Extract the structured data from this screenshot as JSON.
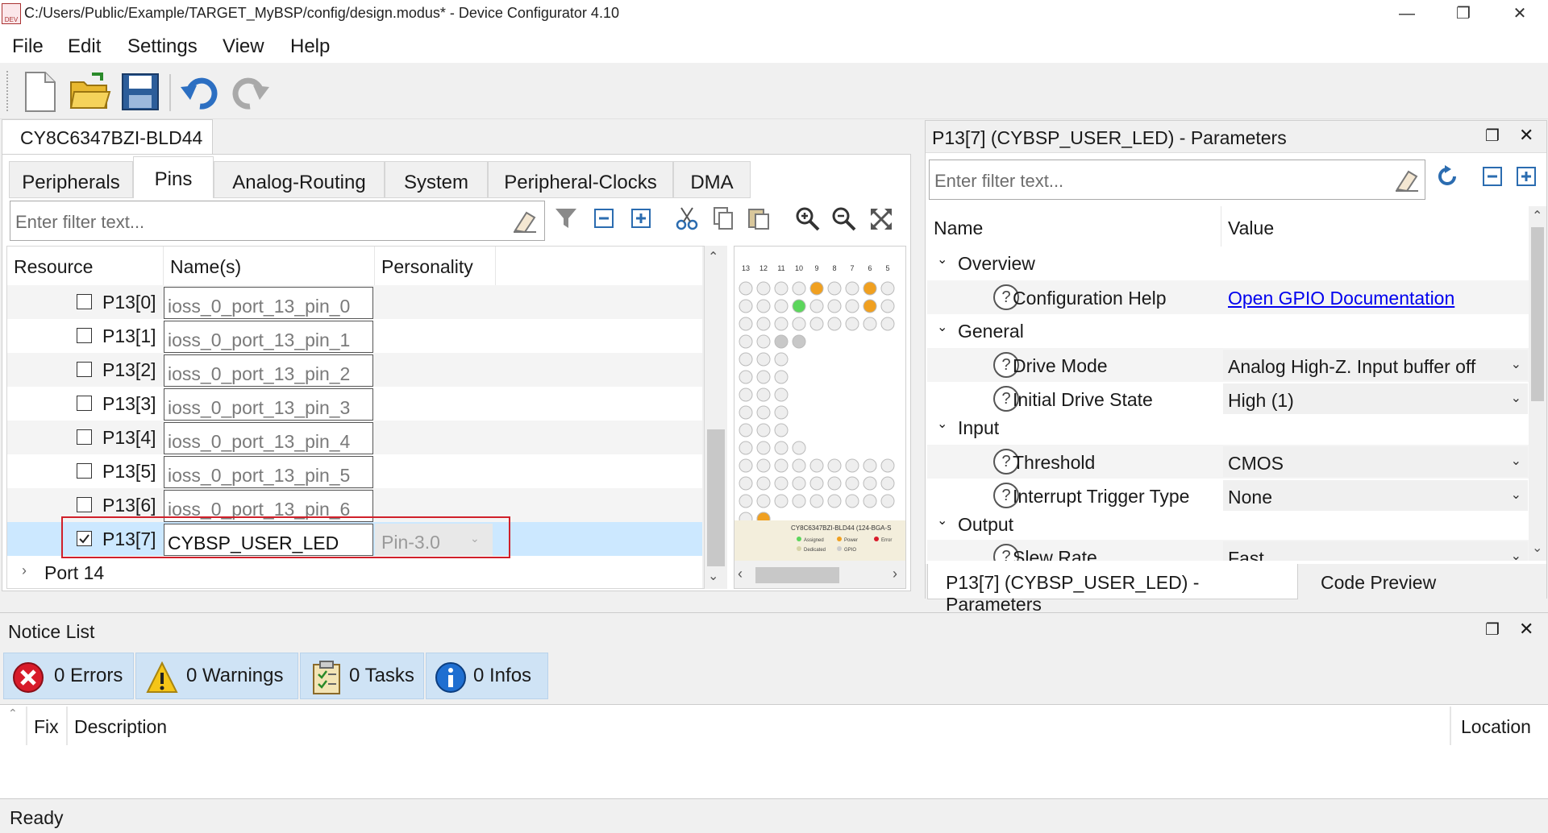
{
  "window": {
    "title": "C:/Users/Public/Example/TARGET_MyBSP/config/design.modus* - Device Configurator 4.10",
    "minimize": "—",
    "restore": "❐",
    "close": "✕"
  },
  "menu": [
    "File",
    "Edit",
    "Settings",
    "View",
    "Help"
  ],
  "device_tab": "CY8C6347BZI-BLD44",
  "tabs": [
    "Peripherals",
    "Pins",
    "Analog-Routing",
    "System",
    "Peripheral-Clocks",
    "DMA"
  ],
  "active_tab": "Pins",
  "pins_filter": {
    "placeholder": "Enter filter text..."
  },
  "pins_table": {
    "headers": [
      "Resource",
      "Name(s)",
      "Personality"
    ],
    "rows": [
      {
        "resource": "P13[0]",
        "name": "ioss_0_port_13_pin_0",
        "checked": false
      },
      {
        "resource": "P13[1]",
        "name": "ioss_0_port_13_pin_1",
        "checked": false
      },
      {
        "resource": "P13[2]",
        "name": "ioss_0_port_13_pin_2",
        "checked": false
      },
      {
        "resource": "P13[3]",
        "name": "ioss_0_port_13_pin_3",
        "checked": false
      },
      {
        "resource": "P13[4]",
        "name": "ioss_0_port_13_pin_4",
        "checked": false
      },
      {
        "resource": "P13[5]",
        "name": "ioss_0_port_13_pin_5",
        "checked": false
      },
      {
        "resource": "P13[6]",
        "name": "ioss_0_port_13_pin_6",
        "checked": false
      }
    ],
    "selected_row": {
      "resource": "P13[7]",
      "name": "CYBSP_USER_LED",
      "personality": "Pin-3.0",
      "checked": true
    },
    "collapsed_row": "Port 14"
  },
  "chip_view": {
    "columns": [
      "13",
      "12",
      "11",
      "10",
      "9",
      "8",
      "7",
      "6",
      "5"
    ],
    "caption": "CY8C6347BZI-BLD44 (124-BGA-S",
    "legend": [
      "Assigned",
      "Power",
      "Error",
      "Dedicated",
      "GPIO"
    ]
  },
  "params_panel": {
    "title": "P13[7] (CYBSP_USER_LED) - Parameters",
    "filter_placeholder": "Enter filter text...",
    "headers": [
      "Name",
      "Value"
    ],
    "groups": {
      "overview": "Overview",
      "general": "General",
      "input": "Input",
      "output": "Output"
    },
    "config_help": {
      "label": "Configuration Help",
      "link": "Open GPIO Documentation"
    },
    "drive_mode": {
      "label": "Drive Mode",
      "value": "Analog High-Z. Input buffer off"
    },
    "initial_drive_state": {
      "label": "Initial Drive State",
      "value": "High (1)"
    },
    "threshold": {
      "label": "Threshold",
      "value": "CMOS"
    },
    "interrupt_trigger": {
      "label": "Interrupt Trigger Type",
      "value": "None"
    },
    "slew_rate": {
      "label": "Slew Rate",
      "value": "Fast"
    },
    "bottom_tabs": [
      "P13[7] (CYBSP_USER_LED) - Parameters",
      "Code Preview"
    ]
  },
  "notice_list": {
    "title": "Notice List",
    "errors": "0 Errors",
    "warnings": "0 Warnings",
    "tasks": "0 Tasks",
    "infos": "0 Infos",
    "headers": [
      "Fix",
      "Description",
      "Location"
    ]
  },
  "status": "Ready",
  "colors": {
    "selection": "#cce8ff",
    "highlight_border": "#d0202a",
    "link": "#0000ee",
    "accent": "#2b6cb0"
  }
}
